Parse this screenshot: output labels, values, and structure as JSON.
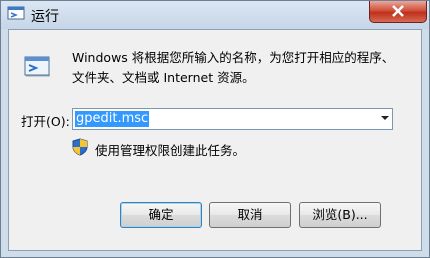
{
  "window": {
    "title": "运行"
  },
  "description": {
    "line1": "Windows 将根据您所输入的名称，为您打开相应的程序、",
    "line2": "文件夹、文档或 Internet 资源。"
  },
  "open_field": {
    "label": "打开(O):",
    "value": "gpedit.msc"
  },
  "admin_note": "使用管理权限创建此任务。",
  "buttons": {
    "ok": "确定",
    "cancel": "取消",
    "browse": "浏览(B)..."
  }
}
